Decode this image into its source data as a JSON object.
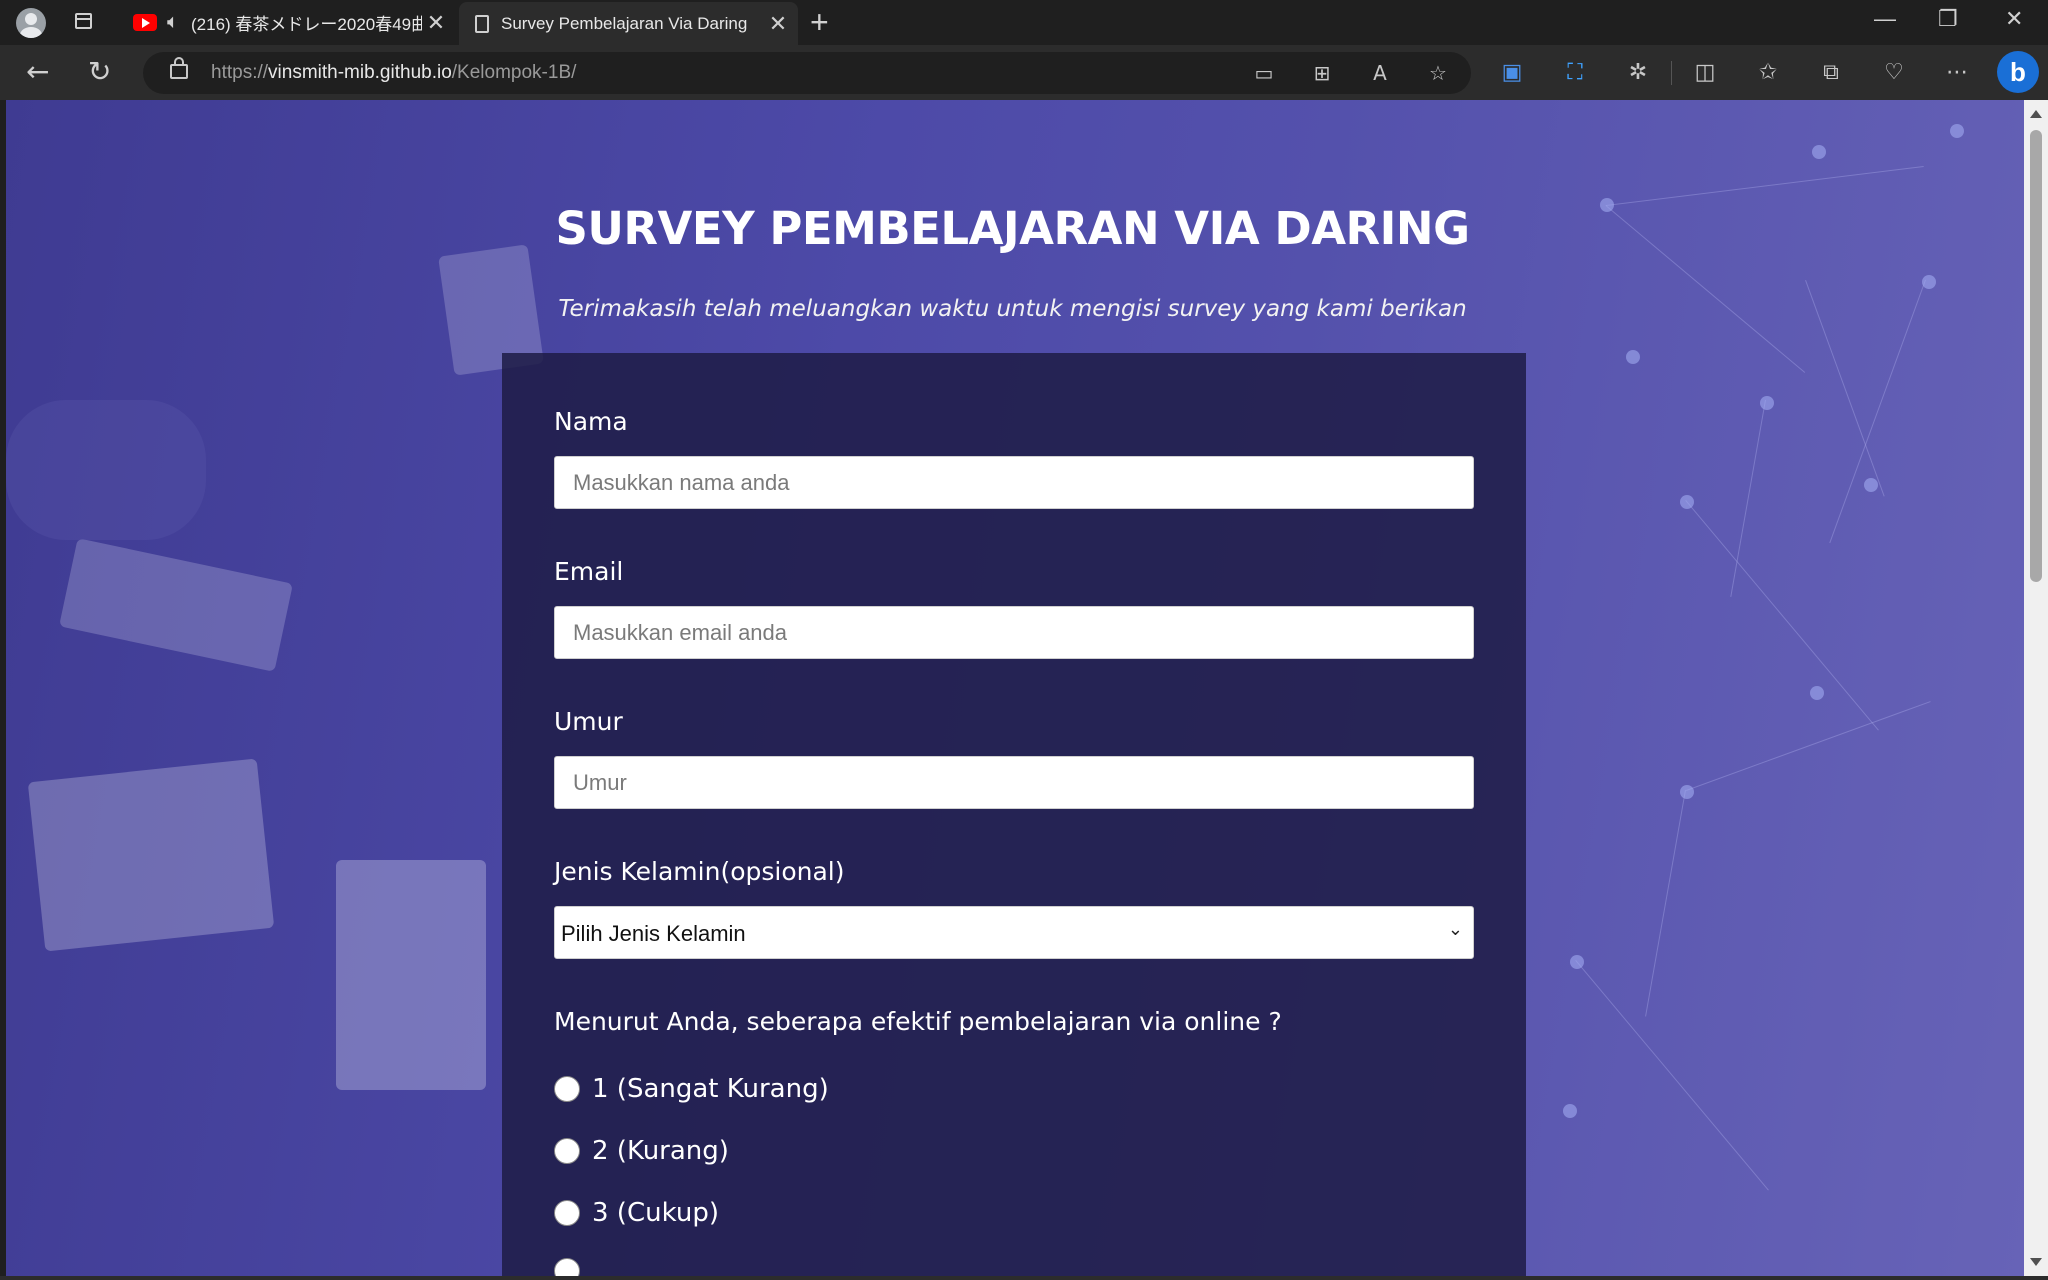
{
  "browser": {
    "tabs": [
      {
        "title": "(216) 春茶メドレー2020春49曲",
        "active": false
      },
      {
        "title": "Survey Pembelajaran Via Daring",
        "active": true
      }
    ],
    "url_prefix": "https://",
    "url_host": "vinsmith-mib.github.io",
    "url_path": "/Kelompok-1B/",
    "icons": [
      "profile-icon",
      "tab-actions-icon",
      "youtube-icon",
      "audio-icon",
      "close-icon",
      "document-icon",
      "new-tab-icon",
      "back-icon",
      "refresh-icon",
      "lock-icon",
      "device-icon",
      "apps-icon",
      "read-aloud-icon",
      "favorite-star-icon",
      "translate-icon",
      "screenshot-icon",
      "extensions-icon",
      "split-screen-icon",
      "favorites-icon",
      "collections-icon",
      "health-icon",
      "more-icon",
      "bing-icon"
    ]
  },
  "survey": {
    "title": "SURVEY PEMBELAJARAN VIA DARING",
    "subtitle": "Terimakasih telah meluangkan waktu untuk mengisi survey yang kami berikan",
    "fields": {
      "name": {
        "label": "Nama",
        "placeholder": "Masukkan nama anda"
      },
      "email": {
        "label": "Email",
        "placeholder": "Masukkan email anda"
      },
      "age": {
        "label": "Umur",
        "placeholder": "Umur"
      },
      "gender": {
        "label": "Jenis Kelamin(opsional)",
        "selected": "Pilih Jenis Kelamin"
      }
    },
    "question": "Menurut Anda, seberapa efektif pembelajaran via online ?",
    "options": [
      {
        "label": "1 (Sangat Kurang)"
      },
      {
        "label": "2 (Kurang)"
      },
      {
        "label": "3 (Cukup)"
      }
    ]
  }
}
